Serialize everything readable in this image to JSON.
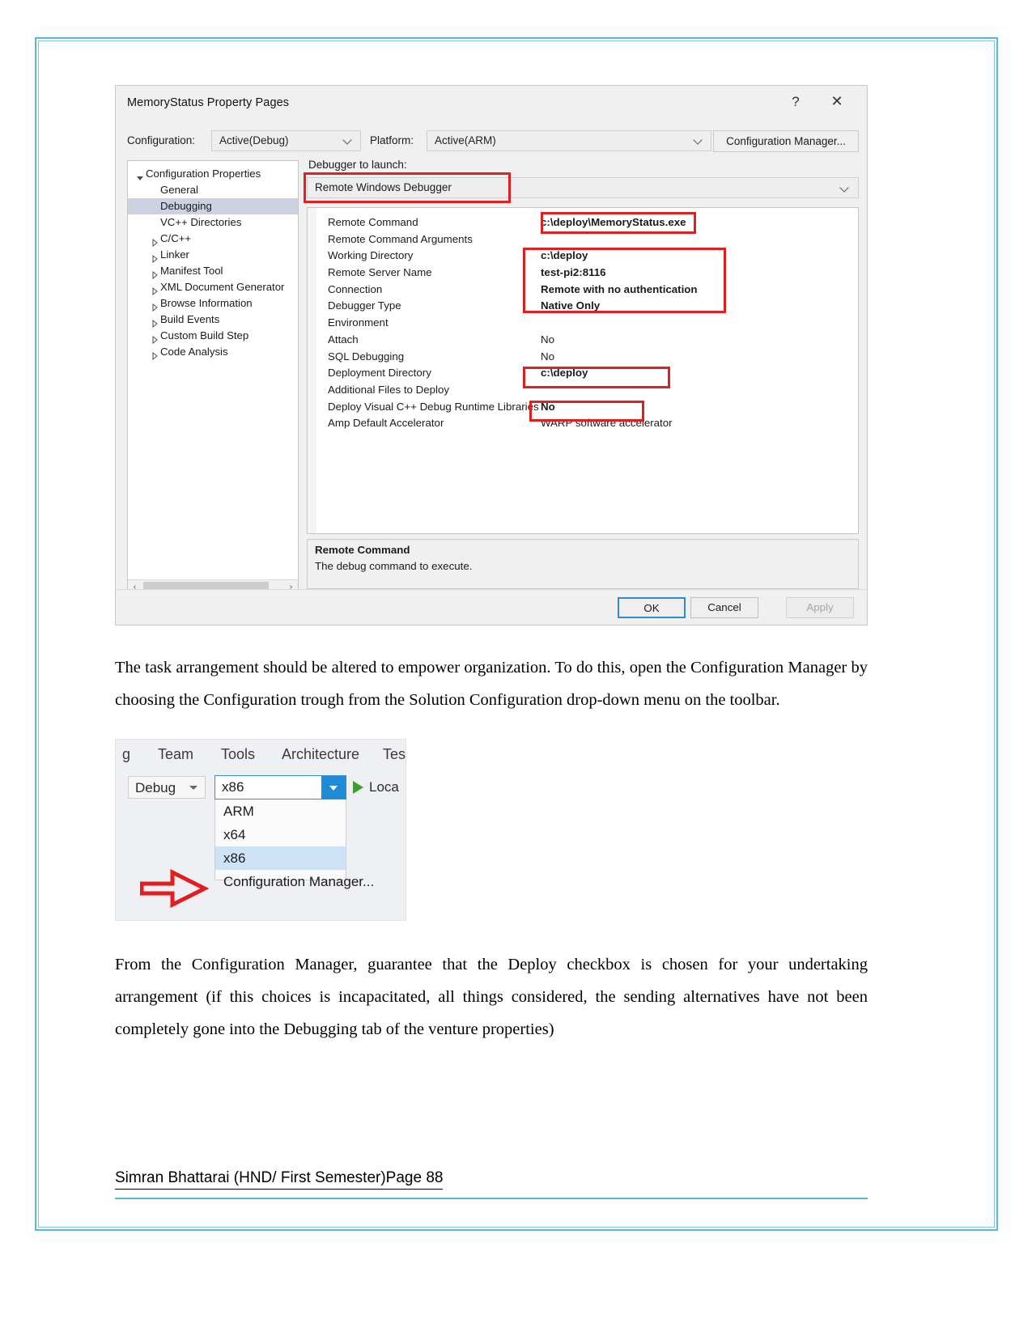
{
  "dialog": {
    "title": "MemoryStatus Property Pages",
    "help_icon": "?",
    "close_icon": "✕",
    "configuration_label": "Configuration:",
    "configuration_value": "Active(Debug)",
    "platform_label": "Platform:",
    "platform_value": "Active(ARM)",
    "configuration_manager_button": "Configuration Manager...",
    "tree": [
      {
        "label": "Configuration Properties",
        "indent": 0,
        "marker": "open",
        "selected": false
      },
      {
        "label": "General",
        "indent": 1,
        "marker": "none",
        "selected": false
      },
      {
        "label": "Debugging",
        "indent": 1,
        "marker": "none",
        "selected": true
      },
      {
        "label": "VC++ Directories",
        "indent": 1,
        "marker": "none",
        "selected": false
      },
      {
        "label": "C/C++",
        "indent": 1,
        "marker": "collapsed",
        "selected": false
      },
      {
        "label": "Linker",
        "indent": 1,
        "marker": "collapsed",
        "selected": false
      },
      {
        "label": "Manifest Tool",
        "indent": 1,
        "marker": "collapsed",
        "selected": false
      },
      {
        "label": "XML Document Generator",
        "indent": 1,
        "marker": "collapsed",
        "selected": false
      },
      {
        "label": "Browse Information",
        "indent": 1,
        "marker": "collapsed",
        "selected": false
      },
      {
        "label": "Build Events",
        "indent": 1,
        "marker": "collapsed",
        "selected": false
      },
      {
        "label": "Custom Build Step",
        "indent": 1,
        "marker": "collapsed",
        "selected": false
      },
      {
        "label": "Code Analysis",
        "indent": 1,
        "marker": "collapsed",
        "selected": false
      }
    ],
    "scroll_left_icon": "‹",
    "scroll_right_icon": "›",
    "debugger_to_launch_label": "Debugger to launch:",
    "debugger_to_launch_value": "Remote Windows Debugger",
    "properties": [
      {
        "name": "Remote Command",
        "value": "c:\\deploy\\MemoryStatus.exe",
        "bold": true
      },
      {
        "name": "Remote Command Arguments",
        "value": "",
        "bold": false
      },
      {
        "name": "Working Directory",
        "value": "c:\\deploy",
        "bold": true
      },
      {
        "name": "Remote Server Name",
        "value": "test-pi2:8116",
        "bold": true
      },
      {
        "name": "Connection",
        "value": "Remote with no authentication",
        "bold": true
      },
      {
        "name": "Debugger Type",
        "value": "Native Only",
        "bold": true
      },
      {
        "name": "Environment",
        "value": "",
        "bold": false
      },
      {
        "name": "Attach",
        "value": "No",
        "bold": false
      },
      {
        "name": "SQL Debugging",
        "value": "No",
        "bold": false
      },
      {
        "name": "Deployment Directory",
        "value": "c:\\deploy",
        "bold": true
      },
      {
        "name": "Additional Files to Deploy",
        "value": "",
        "bold": false
      },
      {
        "name": "Deploy Visual C++ Debug Runtime Libraries",
        "value": "No",
        "bold": true
      },
      {
        "name": "Amp Default Accelerator",
        "value": "WARP software accelerator",
        "bold": false
      }
    ],
    "description_title": "Remote Command",
    "description_body": "The debug command to execute.",
    "ok_button": "OK",
    "cancel_button": "Cancel",
    "apply_button": "Apply",
    "annotation_color": "#e02020"
  },
  "paragraphs": {
    "first": "The task arrangement should be altered to empower organization. To do this, open the Configuration Manager by choosing the Configuration trough from the Solution Configuration drop-down menu on the toolbar.",
    "second": "From the Configuration Manager, guarantee that the Deploy checkbox is chosen for your undertaking arrangement (if this choices is incapacitated, all things considered, the sending alternatives have not been completely gone into the Debugging tab of the venture properties)"
  },
  "toolbar_shot": {
    "menu_items": [
      "g",
      "Team",
      "Tools",
      "Architecture",
      "Test"
    ],
    "solution_configuration": "Debug",
    "solution_platform": "x86",
    "run_label": "Loca",
    "run_icon": "play-icon",
    "dropdown_options": [
      {
        "label": "ARM",
        "selected": false
      },
      {
        "label": "x64",
        "selected": false
      },
      {
        "label": "x86",
        "selected": true
      },
      {
        "label": "Configuration Manager...",
        "selected": false
      }
    ],
    "annotation_color": "#e02020"
  },
  "footer": {
    "text": "Simran Bhattarai (HND/ First Semester)Page 88"
  }
}
